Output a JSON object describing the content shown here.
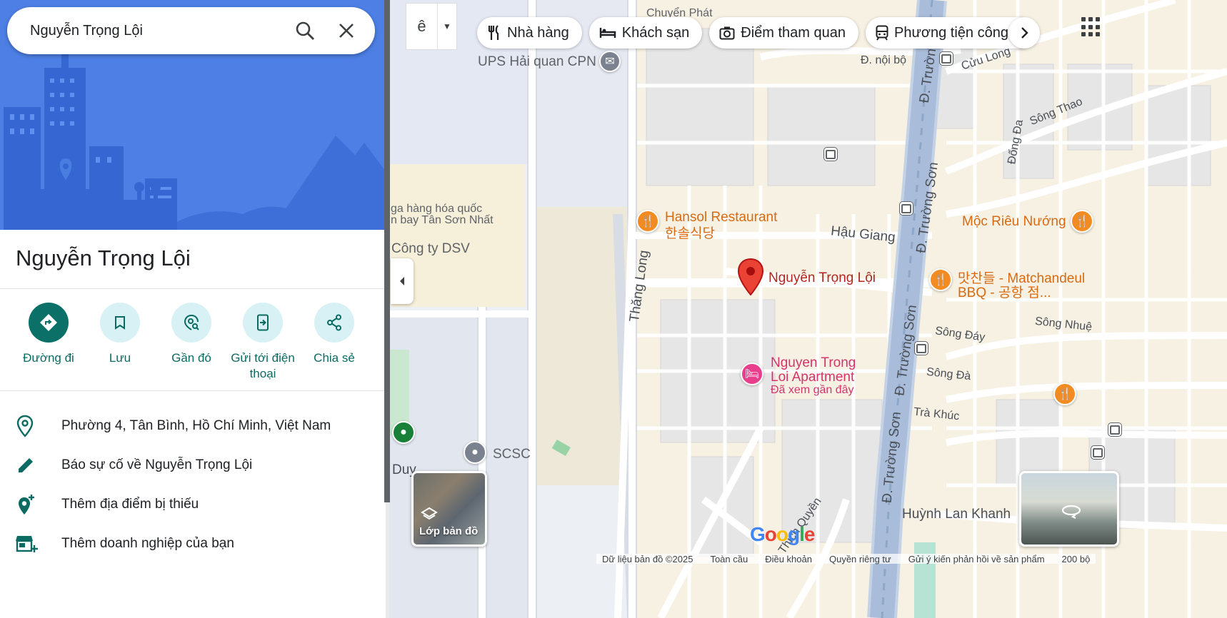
{
  "search": {
    "query": "Nguyễn Trọng Lội"
  },
  "place": {
    "title": "Nguyễn Trọng Lội",
    "actions": [
      {
        "label": "Đường đi",
        "icon": "directions-icon"
      },
      {
        "label": "Lưu",
        "icon": "bookmark-icon"
      },
      {
        "label": "Gần đó",
        "icon": "nearby-icon"
      },
      {
        "label": "Gửi tới điện thoại",
        "icon": "send-to-phone-icon"
      },
      {
        "label": "Chia sẻ",
        "icon": "share-icon"
      }
    ],
    "info": [
      {
        "text": "Phường 4, Tân Bình, Hồ Chí Minh, Việt Nam",
        "icon": "location-pin-icon"
      },
      {
        "text": "Báo sự cố về Nguyễn Trọng Lội",
        "icon": "edit-pencil-icon"
      },
      {
        "text": "Thêm địa điểm bị thiếu",
        "icon": "add-place-icon"
      },
      {
        "text": "Thêm doanh nghiệp của bạn",
        "icon": "add-business-icon"
      }
    ]
  },
  "ime": {
    "char": "ê"
  },
  "chips": [
    {
      "label": "Nhà hàng",
      "icon": "restaurant-icon"
    },
    {
      "label": "Khách sạn",
      "icon": "hotel-icon"
    },
    {
      "label": "Điểm tham quan",
      "icon": "camera-icon"
    },
    {
      "label": "Phương tiện công c",
      "icon": "transit-icon"
    }
  ],
  "map": {
    "labels": {
      "chuyen_phat": "Chuyển Phát",
      "ups": "UPS Hải quan CPN",
      "noi_bo": "Đ. nội bộ",
      "cuu_long": "Cửu Long",
      "song_thao": "Sông Thao",
      "dong_da": "Đống Đa",
      "truong_son_top": "Đ. Trường",
      "truong_son_1": "Đ. Trường Sơn",
      "truong_son_2": "Đ. Trường Sơn",
      "truong_son_3": "Đ. Trường Sơn",
      "hang_hoa_1": "ga hàng hóa quốc",
      "hang_hoa_2": "n bay Tân Sơn Nhất",
      "dsv": "Công ty DSV",
      "hansol_1": "Hansol Restaurant",
      "hansol_2": "한솔식당",
      "hau_giang": "Hậu Giang",
      "moc_rieu": "Mộc Riêu Nướng",
      "thang_long": "Thăng Long",
      "main_place": "Nguyễn Trọng Lội",
      "matchandeul_1": "맛찬들 - Matchandeul",
      "matchandeul_2": "BBQ - 공항 점...",
      "song_day": "Sông Đáy",
      "song_nhue": "Sông Nhuệ",
      "apartment_1": "Nguyen Trong",
      "apartment_2": "Loi Apartment",
      "apartment_3": "Đã xem gần đây",
      "song_da": "Sông Đà",
      "tra_khuc": "Trà Khúc",
      "scsc": "SCSC",
      "duy": "Duy",
      "huynh_lan_khanh": "Huỳnh Lan Khanh",
      "thich_quyen": "Thích Quyền"
    },
    "layers_label": "Lớp bản đồ",
    "footer": [
      "Dữ liệu bản đồ ©2025",
      "Toàn cầu",
      "Điều khoản",
      "Quyền riêng tư",
      "Gửi ý kiến phản hồi về sản phẩm",
      "200 bộ"
    ],
    "logo": "Google"
  }
}
